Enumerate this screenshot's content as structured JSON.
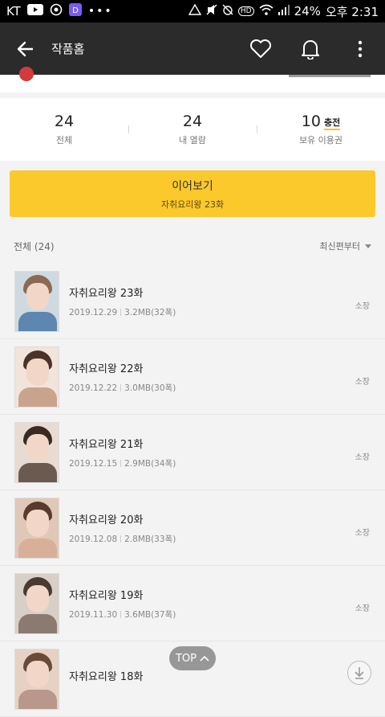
{
  "status_bar": {
    "carrier": "KT",
    "battery": "24%",
    "time": "오후 2:31",
    "hd_badge": "HD"
  },
  "app_bar": {
    "title": "작품홈",
    "icons": [
      "back-arrow-icon",
      "heart-icon",
      "bell-icon",
      "more-icon"
    ]
  },
  "stats": [
    {
      "value": "24",
      "label": "전체"
    },
    {
      "value": "24",
      "label": "내 열람"
    },
    {
      "value": "10",
      "label": "보유 이용권",
      "badge": "충전"
    }
  ],
  "continue_button": {
    "label": "이어보기",
    "episode": "자취요리왕 23화"
  },
  "list_header": {
    "count": "전체 (24)",
    "sort": "최신편부터"
  },
  "episodes": [
    {
      "title": "자취요리왕 23화",
      "date": "2019.12.29",
      "size": "3.2MB(32폭)",
      "status": "소장"
    },
    {
      "title": "자취요리왕 22화",
      "date": "2019.12.22",
      "size": "3.0MB(30폭)",
      "status": "소장"
    },
    {
      "title": "자취요리왕 21화",
      "date": "2019.12.15",
      "size": "2.9MB(34폭)",
      "status": "소장"
    },
    {
      "title": "자취요리왕 20화",
      "date": "2019.12.08",
      "size": "2.8MB(33폭)",
      "status": "소장"
    },
    {
      "title": "자취요리왕 19화",
      "date": "2019.11.30",
      "size": "3.6MB(37폭)",
      "status": "소장"
    },
    {
      "title": "자취요리왕 18화",
      "date": "",
      "size": "",
      "status": ""
    }
  ],
  "top_button": "TOP",
  "colors": {
    "app_bar": "#2b2b2b",
    "accent_yellow": "#fcc92c",
    "background": "#f3f3f3"
  }
}
